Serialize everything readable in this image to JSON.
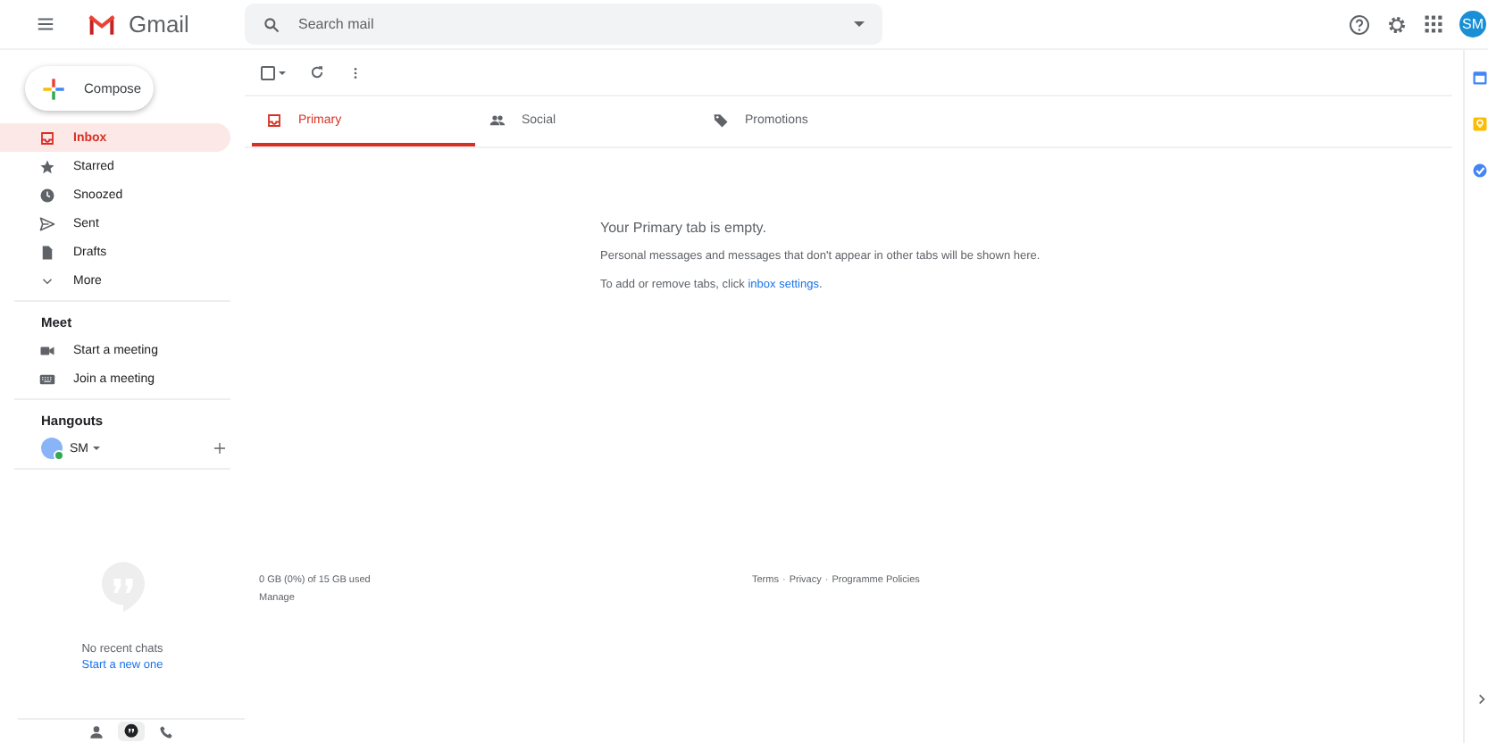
{
  "header": {
    "app_name": "Gmail",
    "search": {
      "placeholder": "Search mail"
    },
    "avatar": "SM"
  },
  "compose": "Compose",
  "select_all": {
    "checked": false
  },
  "nav": [
    {
      "label": "Inbox",
      "kind": "inbox",
      "selected": true
    },
    {
      "label": "Starred",
      "kind": "star",
      "selected": false
    },
    {
      "label": "Snoozed",
      "kind": "clock",
      "selected": false
    },
    {
      "label": "Sent",
      "kind": "send",
      "selected": false
    },
    {
      "label": "Drafts",
      "kind": "draft",
      "selected": false
    },
    {
      "label": "More",
      "kind": "more",
      "selected": false
    }
  ],
  "meet": {
    "title": "Meet",
    "items": [
      {
        "label": "Start a meeting",
        "kind": "video"
      },
      {
        "label": "Join a meeting",
        "kind": "keyboard"
      }
    ]
  },
  "hangouts": {
    "title": "Hangouts",
    "user": "SM",
    "empty_text": "No recent chats",
    "empty_link": "Start a new one"
  },
  "tabs": [
    {
      "label": "Primary",
      "kind": "inbox",
      "selected": true
    },
    {
      "label": "Social",
      "kind": "people",
      "selected": false
    },
    {
      "label": "Promotions",
      "kind": "tag",
      "selected": false
    }
  ],
  "empty": {
    "title": "Your Primary tab is empty.",
    "line": "Personal messages and messages that don't appear in other tabs will be shown here.",
    "hint_before": "To add or remove tabs, click ",
    "hint_link": "inbox settings",
    "hint_after": "."
  },
  "footer": {
    "storage": "0 GB (0%) of 15 GB used",
    "manage": "Manage",
    "separator": "·",
    "links": [
      "Terms",
      "Privacy",
      "Programme Policies"
    ]
  }
}
